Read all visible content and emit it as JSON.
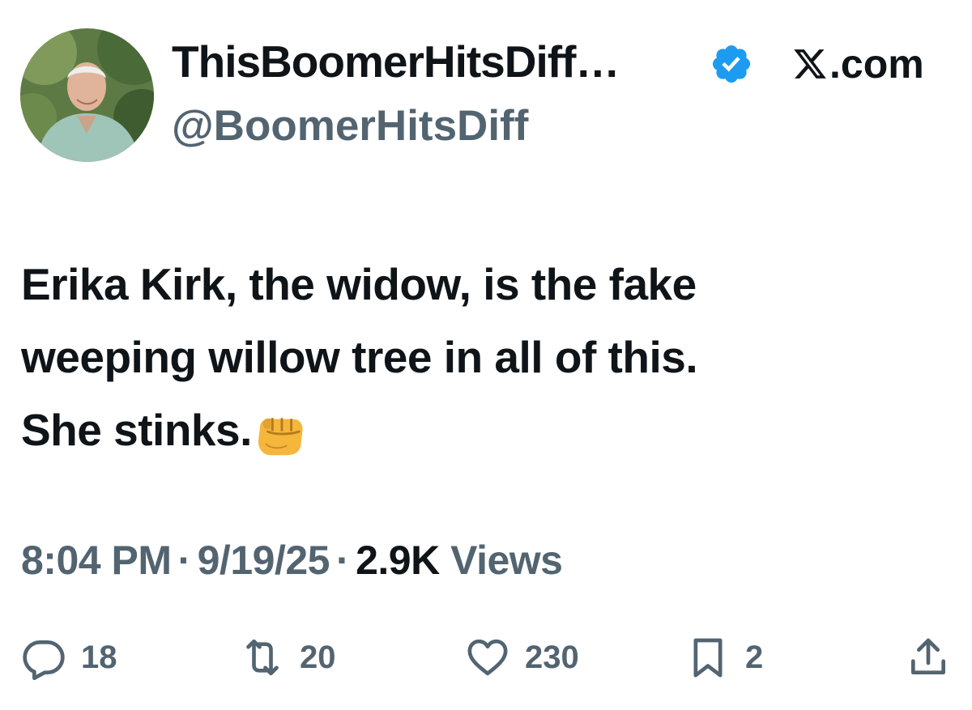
{
  "author": {
    "display_name": "ThisBoomerHitsDiff…",
    "handle": "@BoomerHitsDiff",
    "verified": true,
    "avatar_icon": "profile-photo"
  },
  "branding": {
    "site": ".com",
    "logo_icon": "x-logo-icon"
  },
  "tweet": {
    "lines": [
      "Erika Kirk, the widow, is the fake",
      "weeping willow tree in all of this.",
      "She stinks."
    ],
    "emoji_icon": "oncoming-fist-icon"
  },
  "meta": {
    "time": "8:04 PM",
    "separator": "·",
    "date": "9/19/25",
    "views_count": "2.9K",
    "views_label": "Views"
  },
  "actions": {
    "replies": "18",
    "reposts": "20",
    "likes": "230",
    "bookmarks": "2"
  },
  "colors": {
    "text_primary": "#0f1419",
    "text_secondary": "#536471",
    "verified_blue": "#1d9bf0",
    "background": "#ffffff"
  }
}
